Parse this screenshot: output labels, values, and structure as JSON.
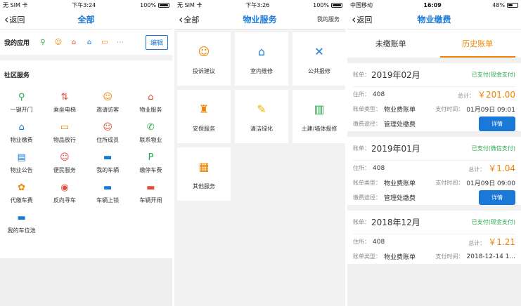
{
  "p1": {
    "status": {
      "left": "无 SIM 卡 ",
      "time": "下午3:24",
      "batt": "100%"
    },
    "back": "返回",
    "title": "全部",
    "myapps_label": "我的应用",
    "edit": "编辑",
    "section": "社区服务",
    "items": [
      {
        "label": "一键开门",
        "icon": "key-icon",
        "g": "⚲",
        "c": "#2aa84a"
      },
      {
        "label": "乘坐电梯",
        "icon": "elevator-icon",
        "g": "⇅",
        "c": "#e24a3a"
      },
      {
        "label": "邀请访客",
        "icon": "visitor-icon",
        "g": "☺",
        "c": "#f08200"
      },
      {
        "label": "物业服务",
        "icon": "house-icon",
        "g": "⌂",
        "c": "#e24a3a"
      },
      {
        "label": "物业缴费",
        "icon": "payment-icon",
        "g": "⌂",
        "c": "#1a78d6"
      },
      {
        "label": "物品放行",
        "icon": "card-icon",
        "g": "▭",
        "c": "#f08200"
      },
      {
        "label": "住所成员",
        "icon": "member-icon",
        "g": "☺",
        "c": "#e24a3a"
      },
      {
        "label": "联系物业",
        "icon": "phone-icon",
        "g": "✆",
        "c": "#2aa84a"
      },
      {
        "label": "物业公告",
        "icon": "notice-icon",
        "g": "▤",
        "c": "#1a78d6"
      },
      {
        "label": "便民服务",
        "icon": "smile-icon",
        "g": "☺",
        "c": "#e24a3a"
      },
      {
        "label": "我的车辆",
        "icon": "car-icon",
        "g": "▬",
        "c": "#1a78d6"
      },
      {
        "label": "缴停车费",
        "icon": "parking-icon",
        "g": "P",
        "c": "#2aa84a"
      },
      {
        "label": "代缴车费",
        "icon": "proxy-pay-icon",
        "g": "✿",
        "c": "#f08200"
      },
      {
        "label": "反向寻车",
        "icon": "find-car-icon",
        "g": "◉",
        "c": "#e24a3a"
      },
      {
        "label": "车辆上锁",
        "icon": "car-lock-icon",
        "g": "▬",
        "c": "#1a78d6"
      },
      {
        "label": "车辆开闸",
        "icon": "gate-icon",
        "g": "▬",
        "c": "#e24a3a"
      },
      {
        "label": "我的车位池",
        "icon": "parking-pool-icon",
        "g": "▬",
        "c": "#1a78d6"
      }
    ]
  },
  "p2": {
    "status": {
      "left": "无 SIM 卡 ",
      "time": "下午3:26",
      "batt": "100%"
    },
    "back": "全部",
    "title": "物业服务",
    "right": "我的服务",
    "tiles": [
      {
        "label": "投诉建议",
        "icon": "complaint-icon",
        "g": "☺",
        "c": "#f08200"
      },
      {
        "label": "室内维修",
        "icon": "repair-icon",
        "g": "⌂",
        "c": "#1a78d6"
      },
      {
        "label": "公共报修",
        "icon": "tools-icon",
        "g": "✕",
        "c": "#1a78d6"
      },
      {
        "label": "安保服务",
        "icon": "security-icon",
        "g": "♜",
        "c": "#f08200"
      },
      {
        "label": "清洁绿化",
        "icon": "broom-icon",
        "g": "✎",
        "c": "#f0b400"
      },
      {
        "label": "土建/墙体报修",
        "icon": "building-icon",
        "g": "▥",
        "c": "#2aa84a"
      },
      {
        "label": "其他服务",
        "icon": "grid-icon",
        "g": "▦",
        "c": "#f08200"
      }
    ]
  },
  "p3": {
    "status": {
      "left": "中国移动",
      "time": "16:09",
      "batt": "48%"
    },
    "back": "返回",
    "title": "物业缴费",
    "tab1": "未缴账单",
    "tab2": "历史账单",
    "lbl_bill": "账单：",
    "lbl_addr": "住所：",
    "lbl_type": "账单类型：",
    "lbl_paytime": "支付时间：",
    "lbl_way": "缴费途径：",
    "lbl_total": "总计：",
    "detail": "详情",
    "bills": [
      {
        "month": "2019年02月",
        "status": "已支付(现金支付)",
        "addr": "408",
        "amount": "￥201.00",
        "type": "物业费账单",
        "time": "01月09日 09:01",
        "way": "管理处缴费"
      },
      {
        "month": "2019年01月",
        "status": "已支付(微信支付)",
        "addr": "408",
        "amount": "￥1.04",
        "type": "物业费账单",
        "time": "01月09日 09:00",
        "way": "管理处缴费"
      },
      {
        "month": "2018年12月",
        "status": "已支付(现金支付)",
        "addr": "408",
        "amount": "￥1.21",
        "type": "物业费账单",
        "time": "2018-12-14 1..."
      }
    ]
  }
}
